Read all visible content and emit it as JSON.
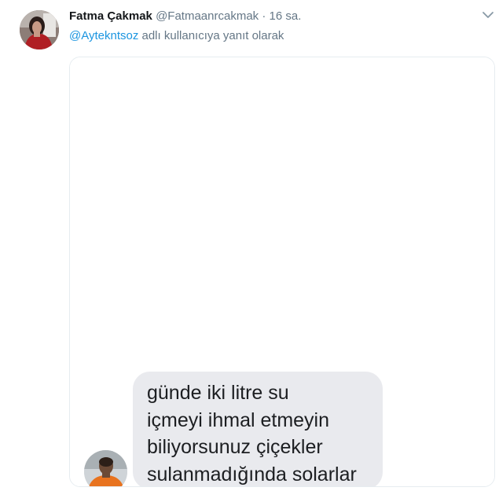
{
  "tweet": {
    "display_name": "Fatma Çakmak",
    "handle": "@Fatmaanrcakmak",
    "separator": "·",
    "time": "16 sa.",
    "reply_mention": "@Aytekntsoz",
    "reply_suffix": "adlı kullanıcıya yanıt olarak"
  },
  "media": {
    "message_lines": [
      "günde iki litre su",
      "içmeyi ihmal etmeyin",
      "biliyorsunuz çiçekler",
      "sulanmadığında solarlar"
    ]
  },
  "icons": {
    "menu": "chevron-down-icon"
  },
  "colors": {
    "name": "#14171a",
    "secondary": "#657786",
    "mention": "#1b95e0",
    "bubble": "#e9eaee",
    "border": "#e6ecf0"
  }
}
